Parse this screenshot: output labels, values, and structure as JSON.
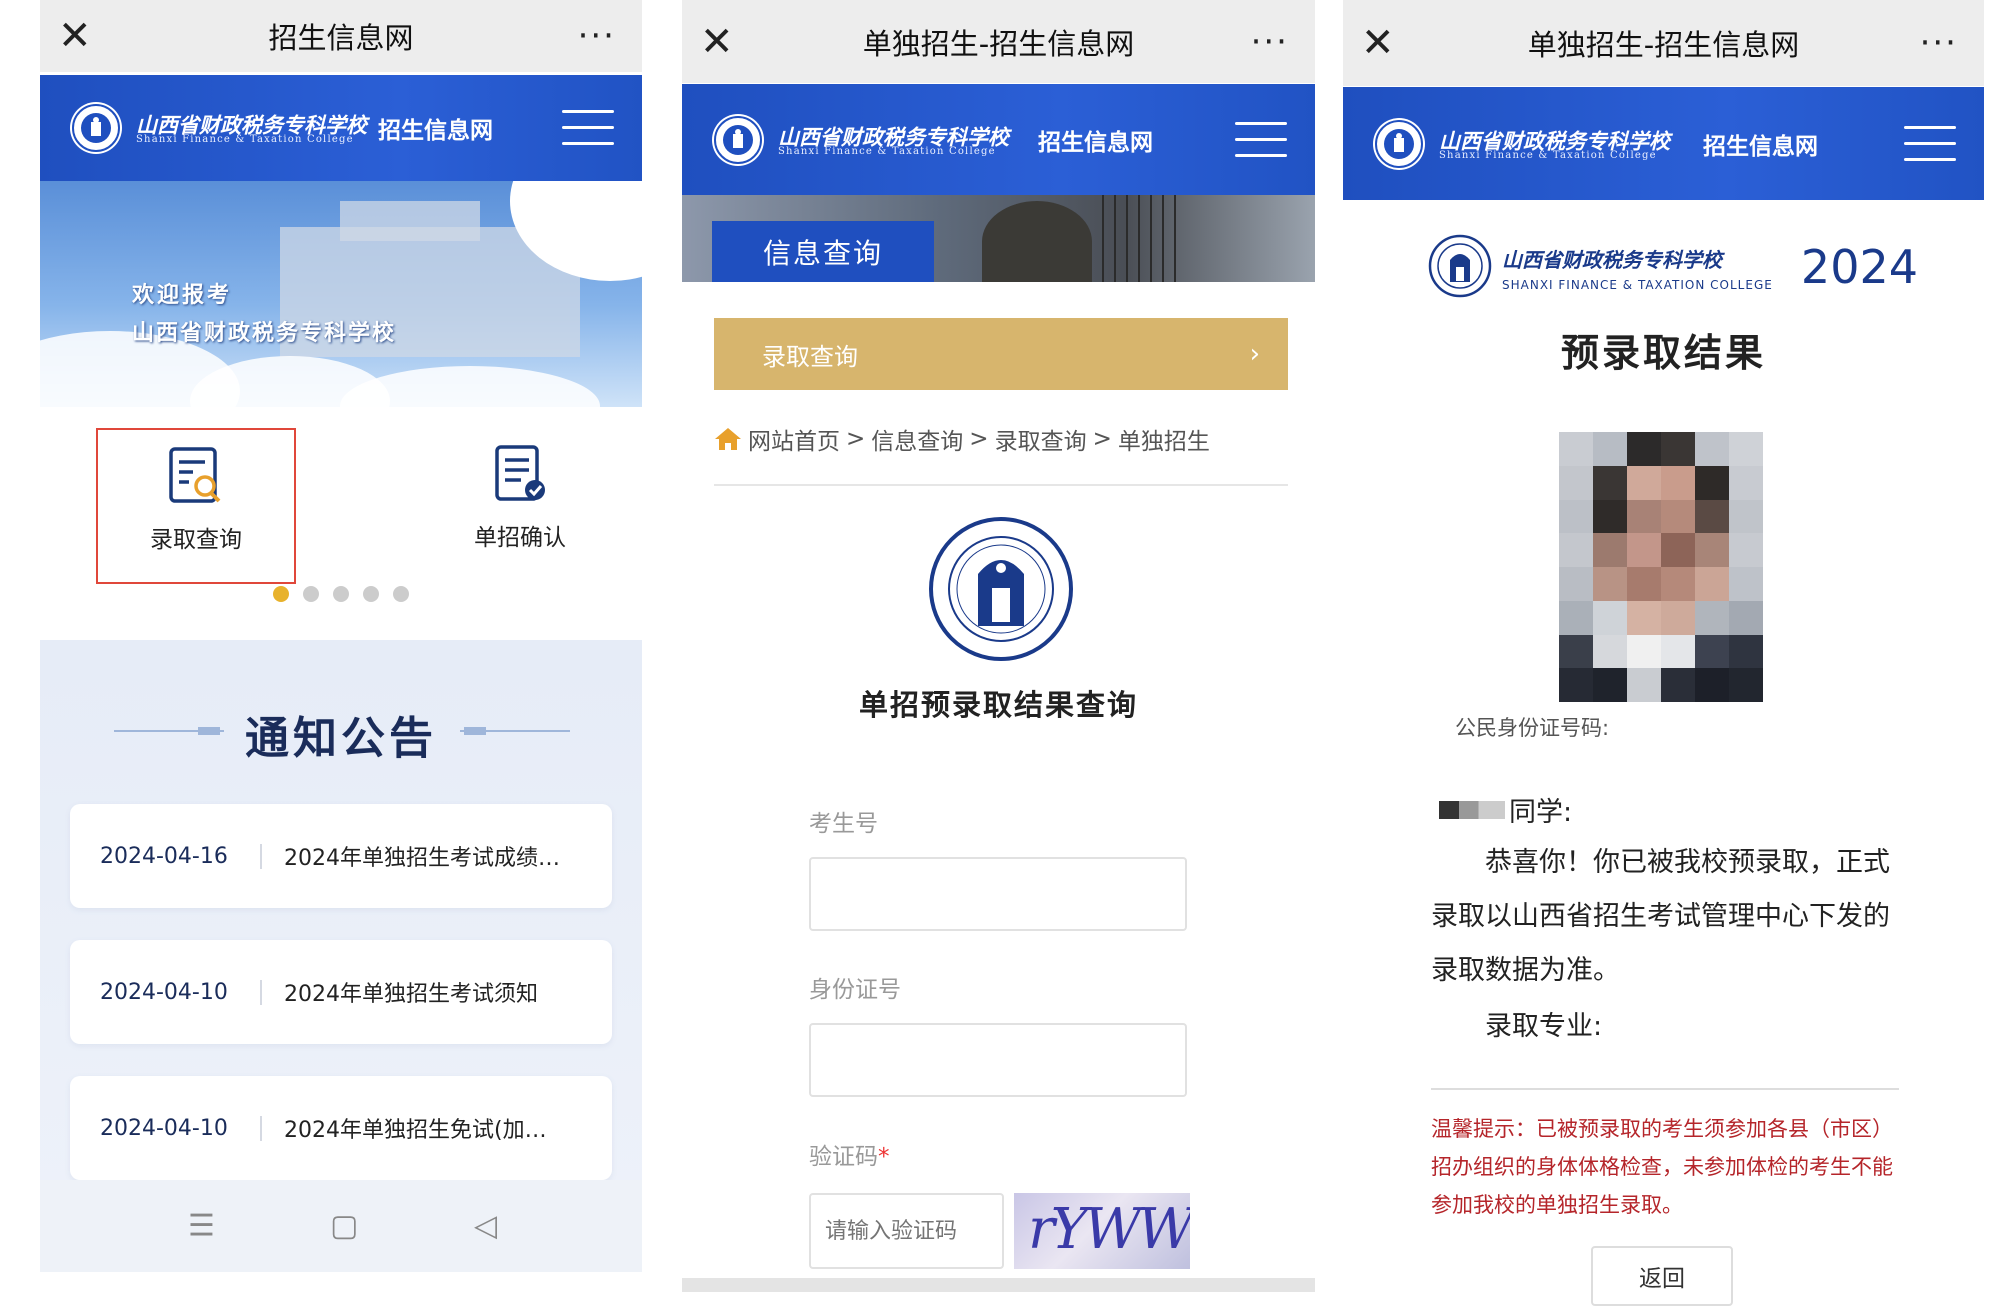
{
  "phone1": {
    "titlebar": {
      "title": "招生信息网",
      "close": "✕",
      "more": "···"
    },
    "brand": {
      "cn_name": "山西省财政税务专科学校",
      "en_name": "Shanxi Finance & Taxation College",
      "site": "招生信息网"
    },
    "banner": {
      "line1": "欢迎报考",
      "line2": "山西省财政税务专科学校"
    },
    "quick": [
      {
        "label": "录取查询",
        "icon": "document-search-icon",
        "highlighted": true
      },
      {
        "label": "单招确认",
        "icon": "document-check-icon",
        "highlighted": false
      }
    ],
    "carousel": {
      "count": 5,
      "active": 1
    },
    "notices": {
      "heading": "通知公告",
      "items": [
        {
          "date": "2024-04-16",
          "title": "2024年单独招生考试成绩…"
        },
        {
          "date": "2024-04-10",
          "title": "2024年单独招生考试须知"
        },
        {
          "date": "2024-04-10",
          "title": "2024年单独招生免试(加…"
        }
      ]
    },
    "nav": {
      "menu": "☰",
      "home": "▢",
      "back": "◁"
    }
  },
  "phone2": {
    "titlebar": {
      "title": "单独招生-招生信息网",
      "close": "✕",
      "more": "···"
    },
    "brand": {
      "cn_name": "山西省财政税务专科学校",
      "en_name": "Shanxi Finance & Taxation College",
      "site": "招生信息网"
    },
    "banner_tag": "信息查询",
    "section_bar": {
      "label": "录取查询",
      "chevron": "›"
    },
    "breadcrumb": [
      "网站首页",
      "信息查询",
      "录取查询",
      "单独招生"
    ],
    "breadcrumb_sep": ">",
    "form": {
      "title": "单招预录取结果查询",
      "exam_no_label": "考生号",
      "exam_no_value": "",
      "id_label": "身份证号",
      "id_value": "",
      "captcha_label": "验证码",
      "captcha_required": "*",
      "captcha_placeholder": "请输入验证码",
      "captcha_text": "rYWW"
    }
  },
  "phone3": {
    "titlebar": {
      "title": "单独招生-招生信息网",
      "close": "✕",
      "more": "···"
    },
    "brand": {
      "cn_name": "山西省财政税务专科学校",
      "en_name": "Shanxi Finance & Taxation College",
      "site": "招生信息网"
    },
    "result_header": {
      "cn_name": "山西省财政税务专科学校",
      "en_name": "SHANXI FINANCE & TAXATION COLLEGE",
      "year": "2024"
    },
    "result_title": "预录取结果",
    "id_label": "公民身份证号码:",
    "greeting_suffix": "同学:",
    "para1": "恭喜你！你已被我校预录取，正式录取以山西省招生考试管理中心下发的录取数据为准。",
    "major_label": "录取专业:",
    "tip": "温馨提示：已被预录取的考生须参加各县（市区）招办组织的身体体格检查，未参加体检的考生不能参加我校的单独招生录取。",
    "back_label": "返回"
  },
  "colors": {
    "brand_blue": "#1f4fbf",
    "gold": "#d7b56d",
    "tip_red": "#b5252a",
    "dot_active": "#e8b22c"
  }
}
